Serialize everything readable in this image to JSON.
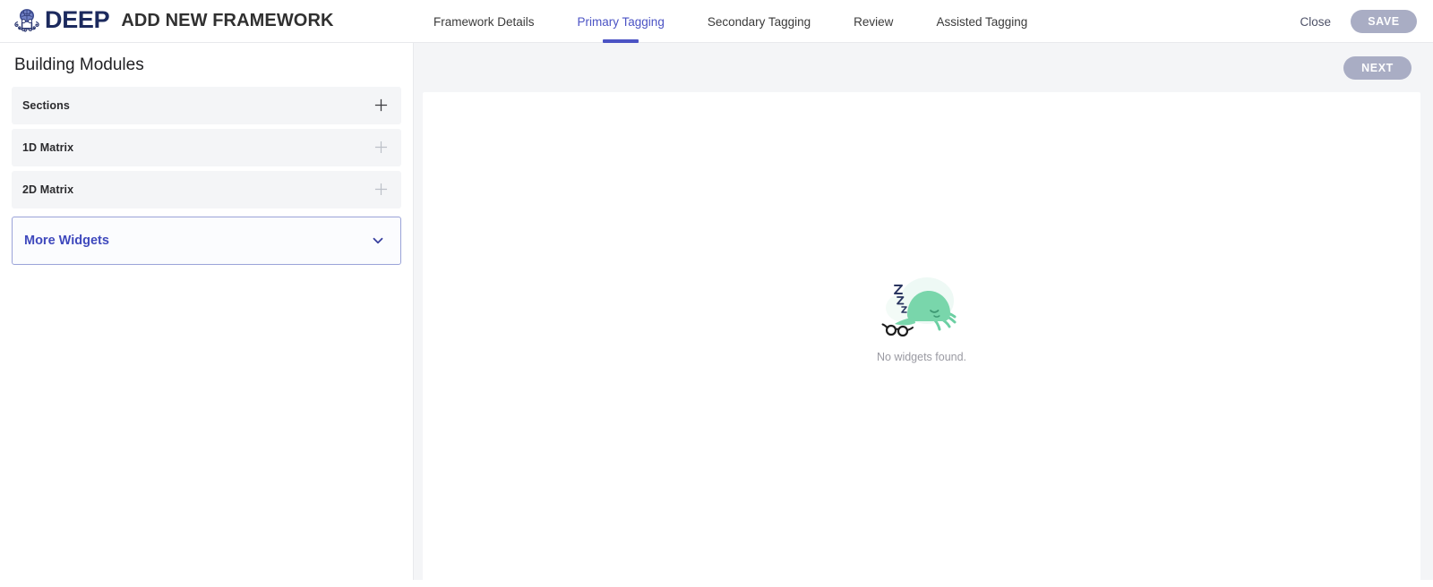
{
  "header": {
    "brand_mark": "deep-octopus-brain-logo",
    "brand_name": "DEEP",
    "page_title": "ADD NEW FRAMEWORK",
    "nav": [
      {
        "label": "Framework Details",
        "active": false
      },
      {
        "label": "Primary Tagging",
        "active": true
      },
      {
        "label": "Secondary Tagging",
        "active": false
      },
      {
        "label": "Review",
        "active": false
      },
      {
        "label": "Assisted Tagging",
        "active": false
      }
    ],
    "close_label": "Close",
    "save_label": "SAVE",
    "accent_color": "#4b53c4",
    "button_color": "#a9adc4"
  },
  "sidebar": {
    "heading": "Building Modules",
    "items": [
      {
        "label": "Sections",
        "icon": "plus-icon",
        "icon_emphasis": "strong"
      },
      {
        "label": "1D Matrix",
        "icon": "plus-icon",
        "icon_emphasis": "faint"
      },
      {
        "label": "2D Matrix",
        "icon": "plus-icon",
        "icon_emphasis": "faint"
      }
    ],
    "more_widgets": {
      "label": "More Widgets",
      "icon": "chevron-down-icon"
    }
  },
  "main": {
    "next_label": "NEXT",
    "empty_state": {
      "illustration": "sleeping-octopus-with-glasses",
      "message": "No widgets found."
    }
  }
}
